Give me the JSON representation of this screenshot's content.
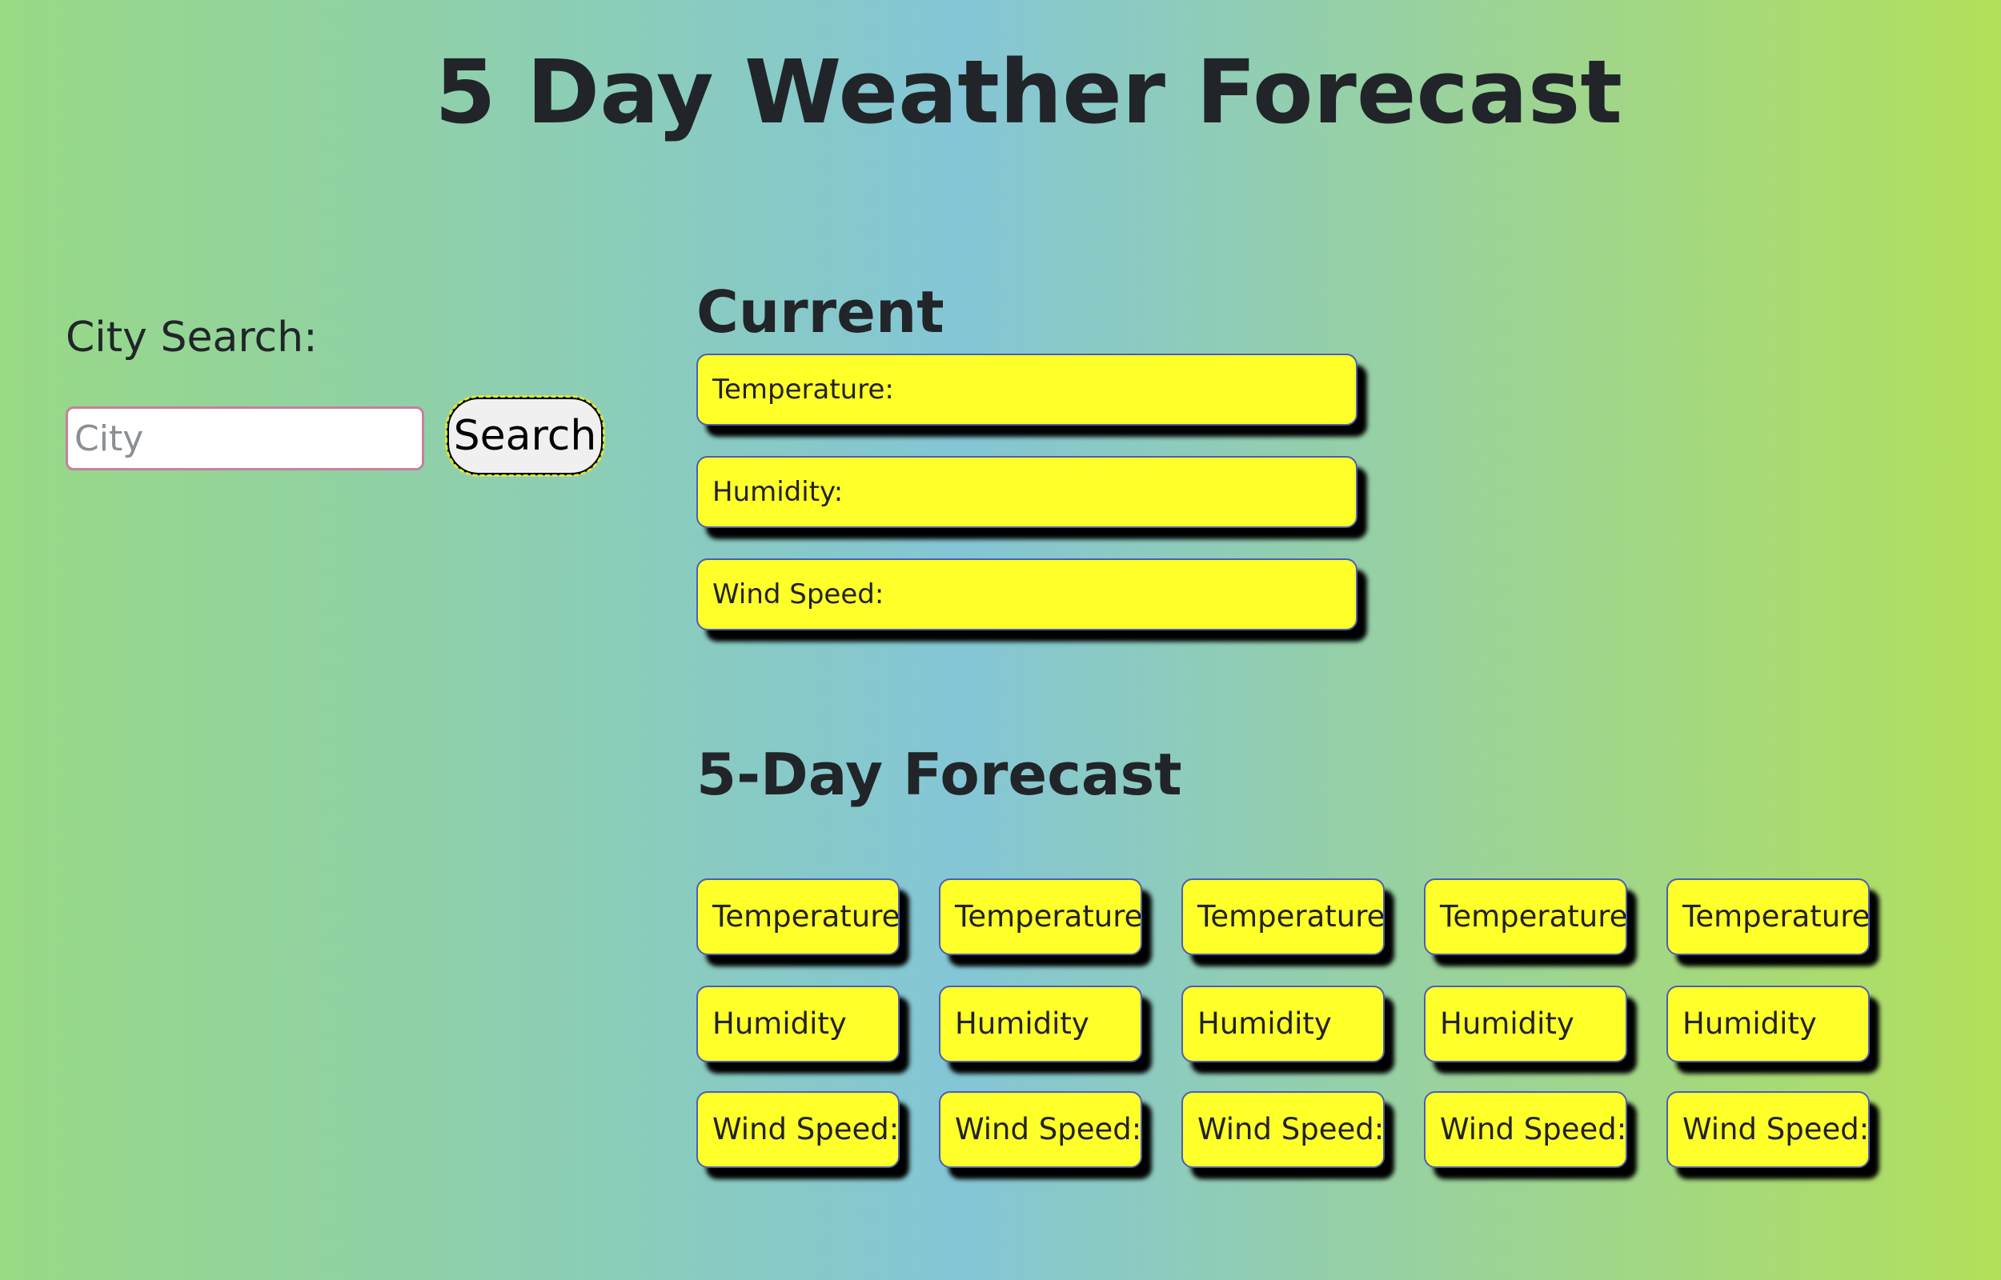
{
  "header": {
    "title": "5 Day Weather Forecast"
  },
  "search": {
    "label": "City Search:",
    "placeholder": "City",
    "value": "",
    "button_label": "Search"
  },
  "current": {
    "heading": "Current",
    "temperature_label": "Temperature:",
    "humidity_label": "Humidity:",
    "wind_label": "Wind Speed:"
  },
  "forecast": {
    "heading": "5-Day Forecast",
    "days": [
      {
        "temperature_label": "Temperature:",
        "humidity_label": "Humidity",
        "wind_label": "Wind Speed:"
      },
      {
        "temperature_label": "Temperature:",
        "humidity_label": "Humidity",
        "wind_label": "Wind Speed:"
      },
      {
        "temperature_label": "Temperature:",
        "humidity_label": "Humidity",
        "wind_label": "Wind Speed:"
      },
      {
        "temperature_label": "Temperature:",
        "humidity_label": "Humidity",
        "wind_label": "Wind Speed:"
      },
      {
        "temperature_label": "Temperature:",
        "humidity_label": "Humidity",
        "wind_label": "Wind Speed:"
      }
    ]
  },
  "colors": {
    "card_background": "#ffff2a",
    "card_border": "#4a5fb4",
    "card_shadow": "#000000",
    "text": "#212529",
    "input_border": "#c77fa0"
  }
}
